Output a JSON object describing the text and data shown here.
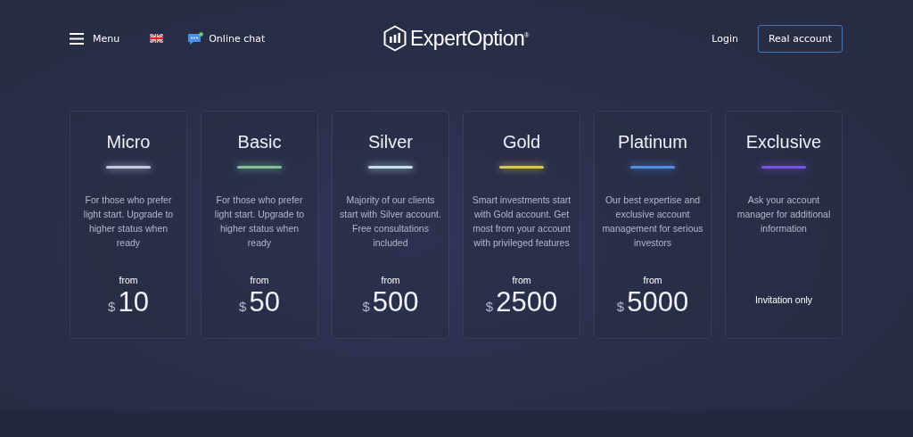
{
  "header": {
    "menu": "Menu",
    "chat": "Online chat",
    "logo": "ExpertOption$^{®}$",
    "login": "Login",
    "real_account": "Real account"
  },
  "plans": [
    {
      "kind": "price",
      "name": "Micro",
      "color": "#c8cbe0",
      "description": "For those who prefer light start. Upgrade to higher status when ready",
      "from": "from",
      "currency": "$",
      "amount": "10"
    },
    {
      "kind": "price",
      "name": "Basic",
      "color": "#7fbf9a",
      "description": "For those who prefer light start. Upgrade to higher status when ready",
      "from": "from",
      "currency": "$",
      "amount": "50"
    },
    {
      "kind": "price",
      "name": "Silver",
      "color": "#c4e2ea",
      "description": "Majority of our clients start with Silver account. Free consultations included",
      "from": "from",
      "currency": "$",
      "amount": "500"
    },
    {
      "kind": "price",
      "name": "Gold",
      "color": "#d6c466",
      "description": "Smart investments start with Gold account. Get most from your account with privileged features",
      "from": "from",
      "currency": "$",
      "amount": "2500"
    },
    {
      "kind": "price",
      "name": "Platinum",
      "color": "#4f8fe0",
      "description": "Our best expertise and exclusive account management for serious investors",
      "from": "from",
      "currency": "$",
      "amount": "5000"
    },
    {
      "kind": "invitation",
      "name": "Exclusive",
      "color": "#7a55e0",
      "description": "Ask your account manager for additional information",
      "note": "Invitation only"
    }
  ]
}
